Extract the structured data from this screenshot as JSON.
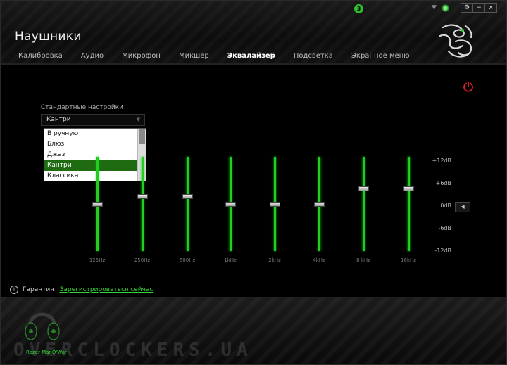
{
  "notification_count": "3",
  "window_controls": {
    "settings": "⚙",
    "minimize": "−",
    "close": "x"
  },
  "device_title": "Наушники",
  "tabs": [
    {
      "label": "Калибровка",
      "active": false
    },
    {
      "label": "Аудио",
      "active": false
    },
    {
      "label": "Микрофон",
      "active": false
    },
    {
      "label": "Микшер",
      "active": false
    },
    {
      "label": "Эквалайзер",
      "active": true
    },
    {
      "label": "Подсветка",
      "active": false
    },
    {
      "label": "Экранное меню",
      "active": false
    }
  ],
  "preset": {
    "label": "Стандартные настройки",
    "selected": "Кантри",
    "options": [
      "В ручную",
      "Блюз",
      "Джаз",
      "Кантри",
      "Классика"
    ],
    "selected_index": 3
  },
  "equalizer": {
    "bands": [
      {
        "label": "125Hz",
        "level_db": 0
      },
      {
        "label": "250Hz",
        "level_db": 2
      },
      {
        "label": "500Hz",
        "level_db": 2
      },
      {
        "label": "1kHz",
        "level_db": 0
      },
      {
        "label": "2kHz",
        "level_db": 0
      },
      {
        "label": "4kHz",
        "level_db": 0
      },
      {
        "label": "8 kHz",
        "level_db": 4
      },
      {
        "label": "16kHz",
        "level_db": 4
      }
    ],
    "db_scale": [
      "+12dB",
      "+6dB",
      "0dB",
      "-6dB",
      "-12dB"
    ],
    "range_db": [
      -12,
      12
    ]
  },
  "warranty": {
    "label": "Гарантия",
    "link": "Зарегистрироваться сейчас"
  },
  "device_name": "Razer ManO'War",
  "watermark": "OVERCLOCKERS.UA",
  "colors": {
    "accent": "#1fce1f",
    "power": "#e02020",
    "selected_option": "#1f6b12"
  }
}
